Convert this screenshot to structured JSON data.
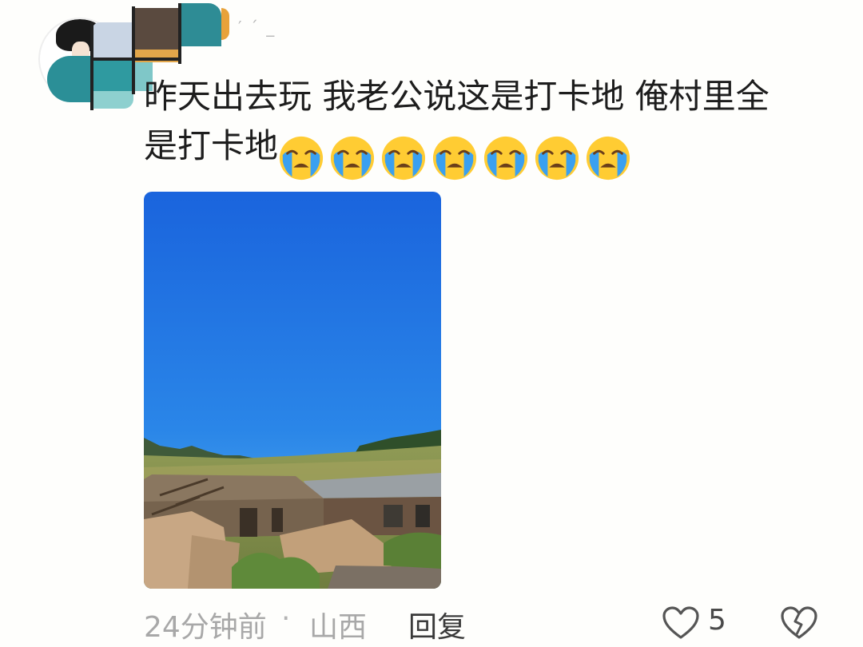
{
  "comment": {
    "line1": "昨天出去玩 我老公说这是打卡地 俺村里全",
    "line2": "是打卡地",
    "emoji_name": "loudly-crying-face",
    "emoji_count": 7
  },
  "username_fragment": "′ ˊ _",
  "footer": {
    "time": "24分钟前",
    "separator": "·",
    "location": "山西",
    "reply_label": "回复",
    "like_count": "5"
  },
  "icons": {
    "like": "heart-outline-icon",
    "dislike": "broken-heart-outline-icon"
  },
  "colors": {
    "text": "#1d1d1d",
    "meta": "#a8a8a8",
    "sky": "#1f6fe0",
    "emoji_face": "#ffcc33",
    "emoji_tears": "#3aa0f0"
  }
}
